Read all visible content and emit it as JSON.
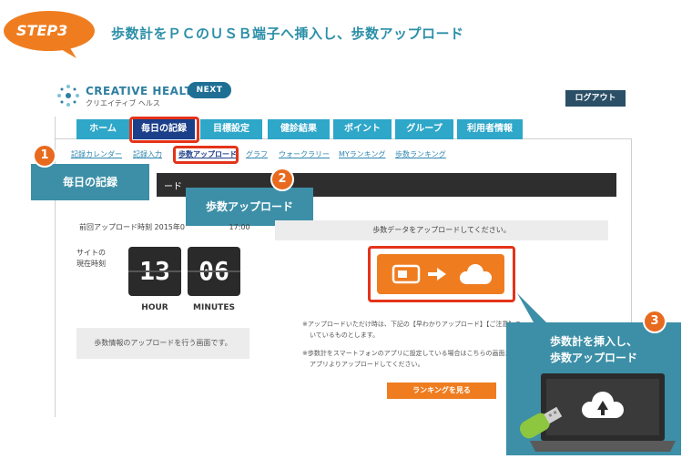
{
  "step": {
    "badge": "STEP3",
    "title": "歩数計をＰＣのＵＳＢ端子へ挿入し、歩数アップロード"
  },
  "logo": {
    "name": "CREATIVE HEALTH",
    "sub": "クリエイティブ ヘルス",
    "badge": "NEXT"
  },
  "header": {
    "logout": "ログアウト"
  },
  "nav": {
    "tabs": [
      "ホーム",
      "毎日の記録",
      "目標設定",
      "健診結果",
      "ポイント",
      "グループ",
      "利用者情報"
    ]
  },
  "subnav": {
    "items": [
      "記録カレンダー",
      "記録入力",
      "歩数アップロード",
      "グラフ",
      "ウォークラリー",
      "MYランキング",
      "歩数ランキング"
    ]
  },
  "callouts": {
    "one": {
      "num": "1",
      "label": "毎日の記録"
    },
    "two": {
      "num": "2",
      "label": "歩数アップロード"
    },
    "three": {
      "num": "3",
      "line1": "歩数計を挿入し、",
      "line2": "歩数アップロード"
    }
  },
  "content": {
    "bar_title": "ード",
    "last_upload": "前回アップロード時刻  2015年0",
    "last_upload_tail": "17:00",
    "site_time_label": "サイトの\n現在時刻",
    "clock": {
      "hour": "13",
      "minute": "06",
      "hour_label": "HOUR",
      "minute_label": "MINUTES"
    },
    "left_info": "歩数情報のアップロードを行う画面です。",
    "upload_prompt": "歩数データをアップロードしてください。",
    "note1": "※アップロードいただけ時は、下記の【早わかりアップロード】【ご注意】の",
    "note1b": "いているものとします。",
    "note2": "※歩数計をスマートフォンのアプリに設定している場合はこちらの画面か",
    "note2b": "アプリよりアップロードしてください。",
    "ranking_button": "ランキングを見る"
  },
  "colors": {
    "accent_orange": "#ef7d20",
    "nav_blue": "#2ea7c9",
    "nav_active": "#1c3f8a",
    "callout_teal": "#3c8fa7",
    "highlight_red": "#e4331a"
  }
}
